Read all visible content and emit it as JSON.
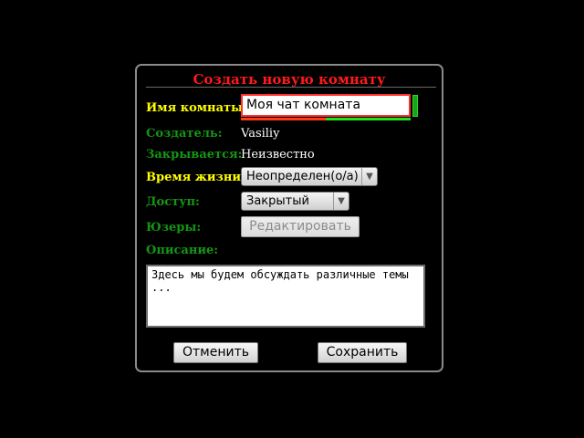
{
  "dialog": {
    "title": "Создать новую комнату",
    "colors": {
      "title": "#ff1a1a",
      "label_active": "#ffff00",
      "label_inactive": "#149614",
      "text": "#ffffff",
      "background": "#000000"
    }
  },
  "room_name": {
    "label": "Имя комнаты:",
    "value": "Моя чат комната",
    "length_meter_fraction": 0.5
  },
  "creator": {
    "label": "Создатель:",
    "value": "Vasiliy"
  },
  "closes": {
    "label": "Закрывается:",
    "value": "Неизвестно"
  },
  "lifetime": {
    "label": "Время жизни:",
    "selected": "Неопределен(о/а)",
    "arrow_icon": "triangle-down-icon"
  },
  "access": {
    "label": "Доступ:",
    "selected": "Закрытый",
    "arrow_icon": "triangle-down-icon"
  },
  "users": {
    "label": "Юзеры:",
    "button_label": "Редактировать"
  },
  "description": {
    "label": "Описание:",
    "value": "Здесь мы будем обсуждать различные темы\n..."
  },
  "actions": {
    "cancel_label": "Отменить",
    "save_label": "Сохранить"
  }
}
